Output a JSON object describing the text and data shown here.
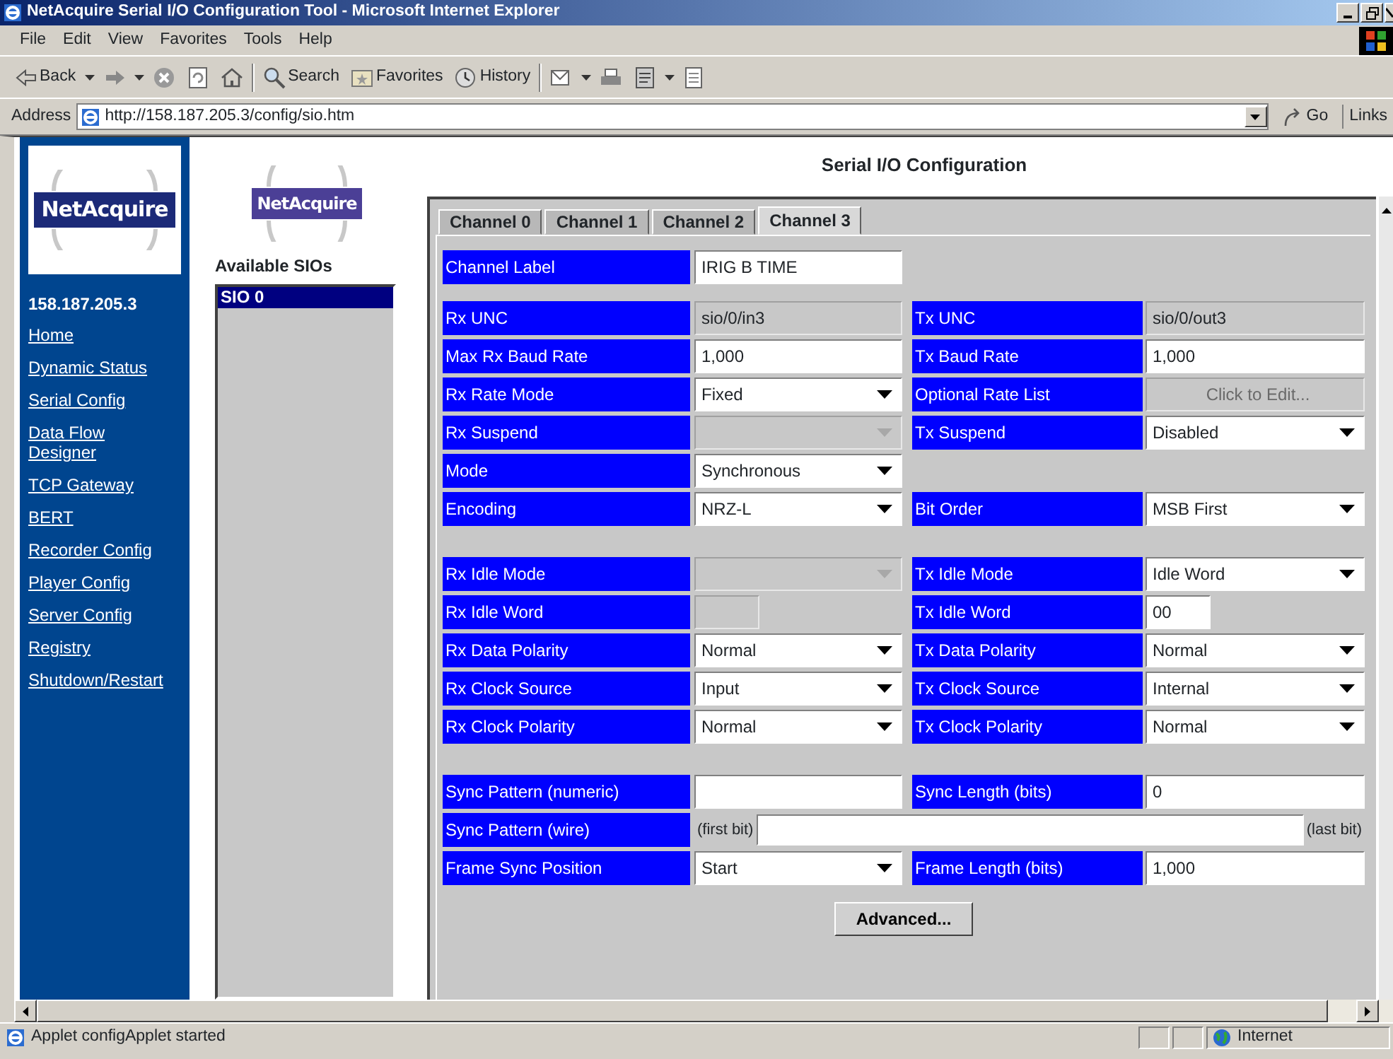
{
  "window": {
    "title": "NetAcquire Serial I/O Configuration Tool - Microsoft Internet Explorer"
  },
  "menu": [
    "File",
    "Edit",
    "View",
    "Favorites",
    "Tools",
    "Help"
  ],
  "toolbar": [
    {
      "kind": "back",
      "label": "Back"
    },
    {
      "kind": "forward"
    },
    {
      "kind": "stop"
    },
    {
      "kind": "refresh"
    },
    {
      "kind": "home"
    },
    {
      "kind": "search",
      "label": "Search"
    },
    {
      "kind": "favorites",
      "label": "Favorites"
    },
    {
      "kind": "history",
      "label": "History"
    },
    {
      "kind": "mail"
    },
    {
      "kind": "print"
    },
    {
      "kind": "edit"
    },
    {
      "kind": "discuss"
    }
  ],
  "address": {
    "label": "Address",
    "url": "http://158.187.205.3/config/sio.htm",
    "go": "Go",
    "links": "Links"
  },
  "nav": {
    "logo": "NetAcquire",
    "host": "158.187.205.3",
    "links": [
      "Home",
      "Dynamic Status",
      "Serial Config",
      "Data Flow Designer",
      "TCP Gateway",
      "BERT",
      "Recorder Config",
      "Player Config",
      "Server Config",
      "Registry",
      "Shutdown/Restart"
    ]
  },
  "sio_panel": {
    "logo": "NetAcquire",
    "heading": "Available SIOs",
    "items": [
      {
        "label": "SIO 0",
        "selected": true
      }
    ]
  },
  "config": {
    "title": "Serial I/O Configuration",
    "tabs": [
      {
        "label": "Channel 0",
        "selected": false
      },
      {
        "label": "Channel 1",
        "selected": false
      },
      {
        "label": "Channel 2",
        "selected": false
      },
      {
        "label": "Channel 3",
        "selected": true
      }
    ],
    "sections": [
      {
        "rows": [
          {
            "left": {
              "label": "Channel Label",
              "kind": "text",
              "value": "IRIG B TIME",
              "disabled": false
            }
          }
        ]
      },
      {
        "rows": [
          {
            "left": {
              "label": "Rx UNC",
              "kind": "text",
              "value": "sio/0/in3",
              "disabled": true
            },
            "right": {
              "label": "Tx UNC",
              "kind": "text",
              "value": "sio/0/out3",
              "disabled": true
            }
          },
          {
            "left": {
              "label": "Max Rx Baud Rate",
              "kind": "text",
              "value": "1,000",
              "disabled": false
            },
            "right": {
              "label": "Tx Baud Rate",
              "kind": "text",
              "value": "1,000",
              "disabled": false
            }
          },
          {
            "left": {
              "label": "Rx Rate Mode",
              "kind": "select",
              "value": "Fixed",
              "disabled": false
            },
            "right": {
              "label": "Optional Rate List",
              "kind": "button",
              "value": "Click to Edit...",
              "disabled": true
            }
          },
          {
            "left": {
              "label": "Rx Suspend",
              "kind": "select",
              "disabled": true
            },
            "right": {
              "label": "Tx Suspend",
              "kind": "select",
              "value": "Disabled",
              "disabled": false
            }
          },
          {
            "left": {
              "label": "Mode",
              "kind": "select",
              "value": "Synchronous",
              "disabled": false
            }
          },
          {
            "left": {
              "label": "Encoding",
              "kind": "select",
              "value": "NRZ-L",
              "disabled": false
            },
            "right": {
              "label": "Bit Order",
              "kind": "select",
              "value": "MSB First",
              "disabled": false
            }
          }
        ]
      },
      {
        "rows": [
          {
            "left": {
              "label": "Rx Idle Mode",
              "kind": "select",
              "disabled": true
            },
            "right": {
              "label": "Tx Idle Mode",
              "kind": "select",
              "value": "Idle Word",
              "disabled": false
            }
          },
          {
            "left": {
              "label": "Rx Idle Word",
              "kind": "short_text",
              "disabled": true
            },
            "right": {
              "label": "Tx Idle Word",
              "kind": "short_text",
              "value": "00",
              "disabled": false
            }
          },
          {
            "left": {
              "label": "Rx Data Polarity",
              "kind": "select",
              "value": "Normal",
              "disabled": false
            },
            "right": {
              "label": "Tx Data Polarity",
              "kind": "select",
              "value": "Normal",
              "disabled": false
            }
          },
          {
            "left": {
              "label": "Rx Clock Source",
              "kind": "select",
              "value": "Input",
              "disabled": false
            },
            "right": {
              "label": "Tx Clock Source",
              "kind": "select",
              "value": "Internal",
              "disabled": false
            }
          },
          {
            "left": {
              "label": "Rx Clock Polarity",
              "kind": "select",
              "value": "Normal",
              "disabled": false
            },
            "right": {
              "label": "Tx Clock Polarity",
              "kind": "select",
              "value": "Normal",
              "disabled": false
            }
          }
        ]
      },
      {
        "rows": [
          {
            "left": {
              "label": "Sync Pattern (numeric)",
              "kind": "text",
              "disabled": false
            },
            "right": {
              "label": "Sync Length (bits)",
              "kind": "text",
              "value": "0",
              "disabled": false
            }
          },
          {
            "left": {
              "label": "Sync Pattern (wire)",
              "kind": "wire",
              "prefix": "(first bit)",
              "suffix": "(last bit)",
              "disabled": false
            }
          },
          {
            "left": {
              "label": "Frame Sync Position",
              "kind": "select",
              "value": "Start",
              "disabled": false
            },
            "right": {
              "label": "Frame Length (bits)",
              "kind": "text",
              "value": "1,000",
              "disabled": false
            }
          }
        ]
      }
    ],
    "advanced": "Advanced..."
  },
  "status_bar": {
    "text": "Applet configApplet started",
    "zone": "Internet"
  }
}
